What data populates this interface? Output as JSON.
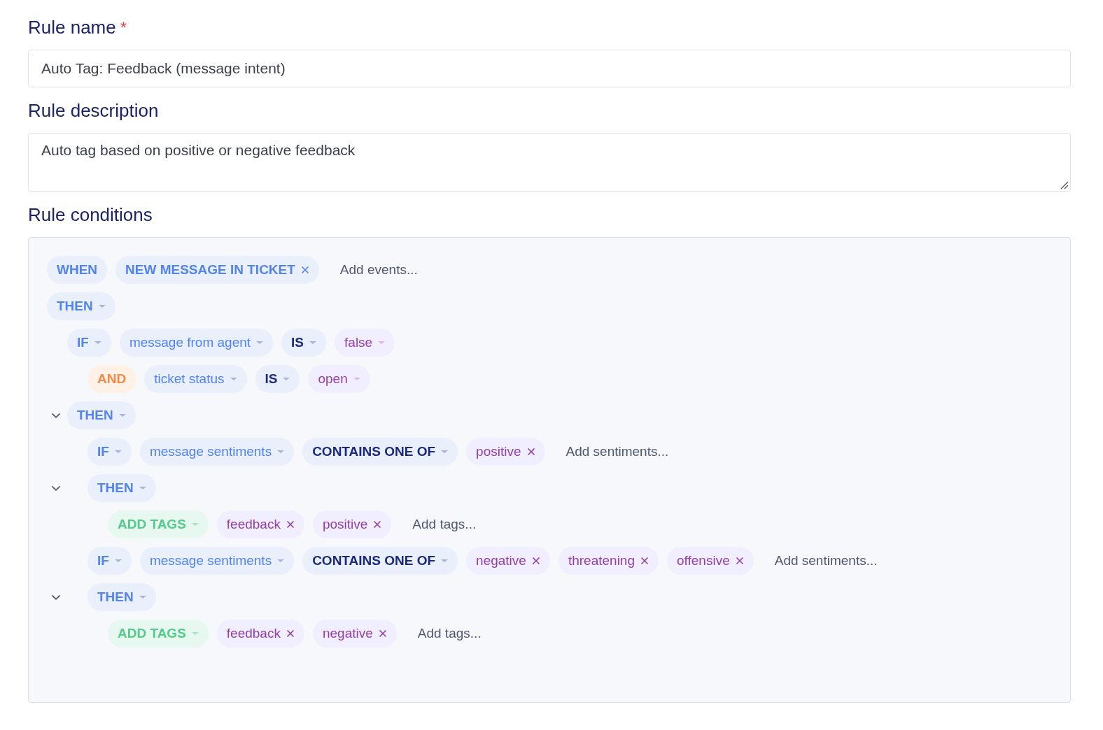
{
  "rule_name": {
    "label": "Rule name",
    "required_mark": "*",
    "value": "Auto Tag: Feedback (message intent)"
  },
  "rule_description": {
    "label": "Rule description",
    "value": "Auto tag based on positive or negative feedback"
  },
  "rule_conditions": {
    "label": "Rule conditions",
    "rows": [
      {
        "tokens": [
          {
            "kind": "keyword",
            "text": "WHEN",
            "dropdown": false,
            "removable": false
          },
          {
            "kind": "keyword",
            "text": "NEW MESSAGE IN TICKET",
            "dropdown": false,
            "removable": true
          }
        ],
        "placeholder": "Add events..."
      },
      {
        "tokens": [
          {
            "kind": "keyword",
            "text": "THEN",
            "dropdown": true,
            "removable": false
          }
        ],
        "children": [
          {
            "tokens": [
              {
                "kind": "keyword",
                "text": "IF",
                "dropdown": true,
                "removable": false
              },
              {
                "kind": "field",
                "text": "message from agent",
                "dropdown": true,
                "removable": false
              },
              {
                "kind": "operator",
                "text": "IS",
                "dropdown": true,
                "removable": false
              },
              {
                "kind": "value",
                "text": "false",
                "dropdown": true,
                "removable": false
              }
            ],
            "children": [
              {
                "tokens": [
                  {
                    "kind": "conjunction",
                    "text": "AND",
                    "dropdown": false,
                    "removable": false
                  },
                  {
                    "kind": "field",
                    "text": "ticket status",
                    "dropdown": true,
                    "removable": false
                  },
                  {
                    "kind": "operator",
                    "text": "IS",
                    "dropdown": true,
                    "removable": false
                  },
                  {
                    "kind": "value",
                    "text": "open",
                    "dropdown": true,
                    "removable": false
                  }
                ]
              }
            ]
          },
          {
            "expanded": true,
            "tokens": [
              {
                "kind": "keyword",
                "text": "THEN",
                "dropdown": true,
                "removable": false
              }
            ],
            "children": [
              {
                "tokens": [
                  {
                    "kind": "keyword",
                    "text": "IF",
                    "dropdown": true,
                    "removable": false
                  },
                  {
                    "kind": "field",
                    "text": "message sentiments",
                    "dropdown": true,
                    "removable": false
                  },
                  {
                    "kind": "operator",
                    "text": "CONTAINS ONE OF",
                    "dropdown": true,
                    "removable": false
                  },
                  {
                    "kind": "value",
                    "text": "positive",
                    "dropdown": false,
                    "removable": true
                  }
                ],
                "placeholder": "Add sentiments..."
              },
              {
                "expanded": true,
                "tokens": [
                  {
                    "kind": "keyword",
                    "text": "THEN",
                    "dropdown": true,
                    "removable": false
                  }
                ],
                "children": [
                  {
                    "tokens": [
                      {
                        "kind": "action",
                        "text": "ADD TAGS",
                        "dropdown": true,
                        "removable": false
                      },
                      {
                        "kind": "value",
                        "text": "feedback",
                        "dropdown": false,
                        "removable": true
                      },
                      {
                        "kind": "value",
                        "text": "positive",
                        "dropdown": false,
                        "removable": true
                      }
                    ],
                    "placeholder": "Add tags..."
                  }
                ]
              },
              {
                "tokens": [
                  {
                    "kind": "keyword",
                    "text": "IF",
                    "dropdown": true,
                    "removable": false
                  },
                  {
                    "kind": "field",
                    "text": "message sentiments",
                    "dropdown": true,
                    "removable": false
                  },
                  {
                    "kind": "operator",
                    "text": "CONTAINS ONE OF",
                    "dropdown": true,
                    "removable": false
                  },
                  {
                    "kind": "value",
                    "text": "negative",
                    "dropdown": false,
                    "removable": true
                  },
                  {
                    "kind": "value",
                    "text": "threatening",
                    "dropdown": false,
                    "removable": true
                  },
                  {
                    "kind": "value",
                    "text": "offensive",
                    "dropdown": false,
                    "removable": true
                  }
                ],
                "placeholder": "Add sentiments..."
              },
              {
                "expanded": true,
                "tokens": [
                  {
                    "kind": "keyword",
                    "text": "THEN",
                    "dropdown": true,
                    "removable": false
                  }
                ],
                "children": [
                  {
                    "tokens": [
                      {
                        "kind": "action",
                        "text": "ADD TAGS",
                        "dropdown": true,
                        "removable": false
                      },
                      {
                        "kind": "value",
                        "text": "feedback",
                        "dropdown": false,
                        "removable": true
                      },
                      {
                        "kind": "value",
                        "text": "negative",
                        "dropdown": false,
                        "removable": true
                      }
                    ],
                    "placeholder": "Add tags..."
                  }
                ]
              }
            ]
          }
        ]
      }
    ]
  }
}
